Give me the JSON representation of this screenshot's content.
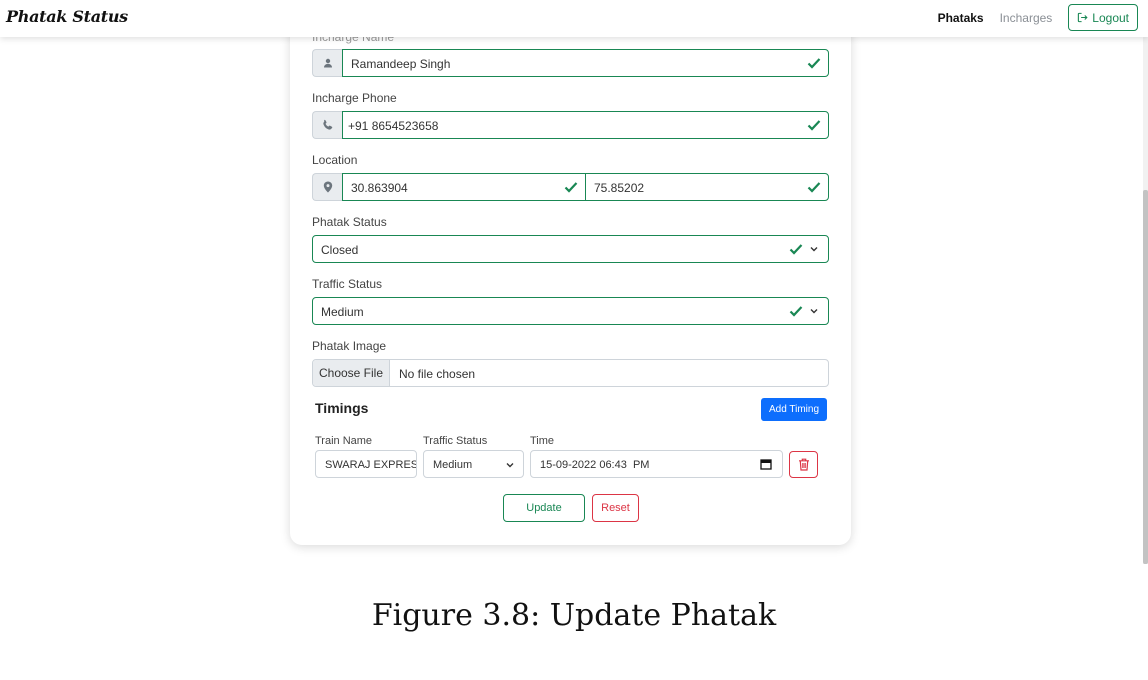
{
  "navbar": {
    "brand": "Phatak Status",
    "links": [
      "Phataks",
      "Incharges"
    ],
    "logout_label": "Logout"
  },
  "form": {
    "incharge_name": {
      "label": "Incharge Name",
      "value": "Ramandeep Singh"
    },
    "incharge_phone": {
      "label": "Incharge Phone",
      "value": "+91 8654523658"
    },
    "location": {
      "label": "Location",
      "latitude": "30.863904",
      "longitude": "75.85202"
    },
    "phatak_status": {
      "label": "Phatak Status",
      "value": "Closed"
    },
    "traffic_status": {
      "label": "Traffic Status",
      "value": "Medium"
    },
    "phatak_image": {
      "label": "Phatak Image",
      "button": "Choose File",
      "status": "No file chosen"
    }
  },
  "timings": {
    "title": "Timings",
    "add_label": "Add Timing",
    "columns": [
      "Train Name",
      "Traffic Status",
      "Time"
    ],
    "rows": [
      {
        "train_name": "SWARAJ EXPRESS",
        "traffic_status": "Medium",
        "time": "15-09-2022 06:43  PM"
      }
    ]
  },
  "actions": {
    "update_label": "Update",
    "reset_label": "Reset"
  },
  "caption": "Figure 3.8: Update Phatak",
  "colors": {
    "success": "#198754",
    "primary": "#0d6efd",
    "danger": "#dc3545"
  },
  "icons": [
    "person-icon",
    "phone-icon",
    "map-pin-icon",
    "check-icon",
    "chevron-down-icon",
    "calendar-icon",
    "trash-icon",
    "logout-icon"
  ]
}
